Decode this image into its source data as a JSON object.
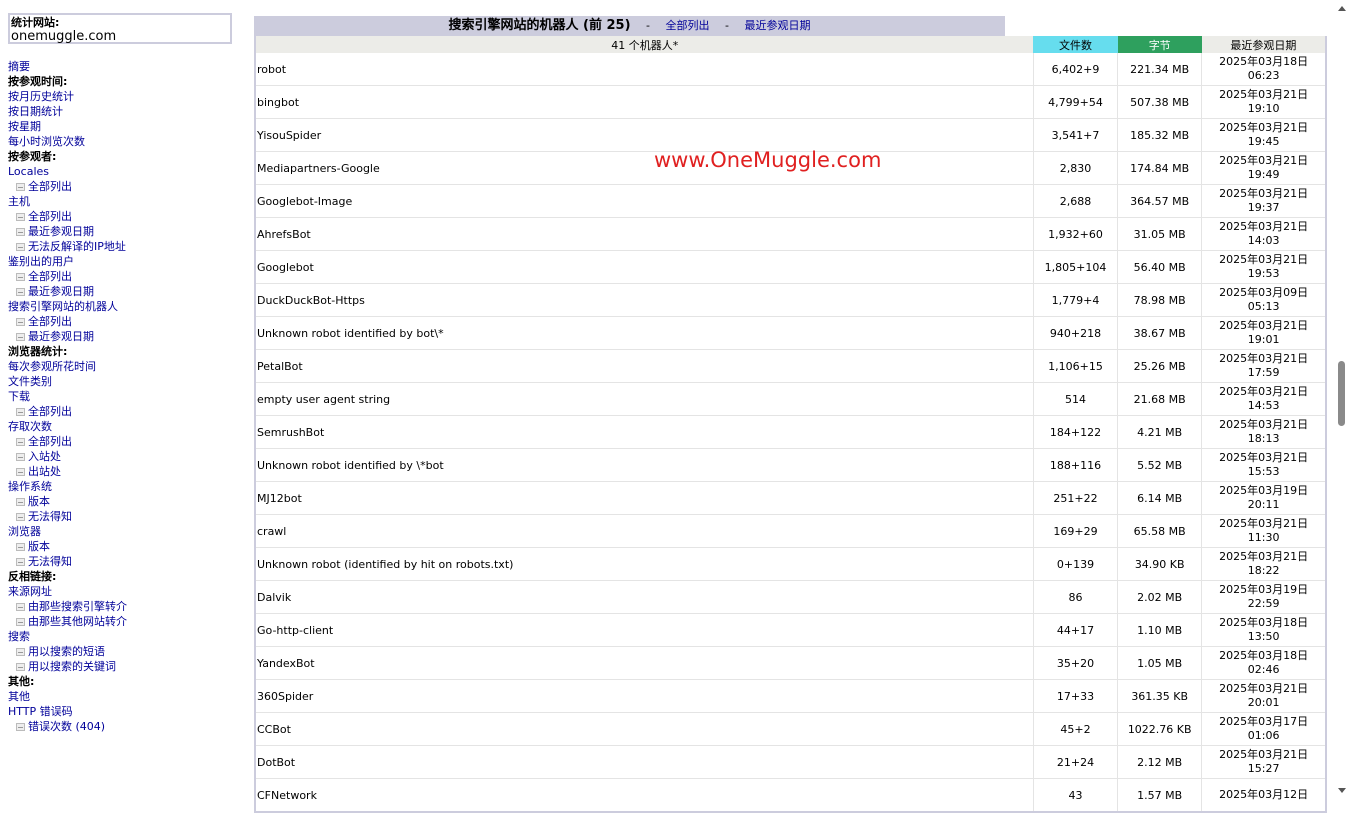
{
  "site": {
    "label": "统计网站:",
    "value": "onemuggle.com"
  },
  "menu": [
    {
      "text": "摘要",
      "type": "link"
    },
    {
      "text": "按参观时间:",
      "type": "header"
    },
    {
      "text": "按月历史统计",
      "type": "link"
    },
    {
      "text": "按日期统计",
      "type": "link"
    },
    {
      "text": "按星期",
      "type": "link"
    },
    {
      "text": "每小时浏览次数",
      "type": "link"
    },
    {
      "text": "按参观者:",
      "type": "header"
    },
    {
      "text": "Locales",
      "type": "link"
    },
    {
      "text": "全部列出",
      "type": "sub"
    },
    {
      "text": "主机",
      "type": "link"
    },
    {
      "text": "全部列出",
      "type": "sub"
    },
    {
      "text": "最近参观日期",
      "type": "sub"
    },
    {
      "text": "无法反解译的IP地址",
      "type": "sub"
    },
    {
      "text": "鉴别出的用户",
      "type": "link"
    },
    {
      "text": "全部列出",
      "type": "sub"
    },
    {
      "text": "最近参观日期",
      "type": "sub"
    },
    {
      "text": "搜索引擎网站的机器人",
      "type": "link"
    },
    {
      "text": "全部列出",
      "type": "sub"
    },
    {
      "text": "最近参观日期",
      "type": "sub"
    },
    {
      "text": "浏览器统计:",
      "type": "header"
    },
    {
      "text": "每次参观所花时间",
      "type": "link"
    },
    {
      "text": "文件类别",
      "type": "link"
    },
    {
      "text": "下载",
      "type": "link"
    },
    {
      "text": "全部列出",
      "type": "sub"
    },
    {
      "text": "存取次数",
      "type": "link"
    },
    {
      "text": "全部列出",
      "type": "sub"
    },
    {
      "text": "入站处",
      "type": "sub"
    },
    {
      "text": "出站处",
      "type": "sub"
    },
    {
      "text": "操作系统",
      "type": "link"
    },
    {
      "text": "版本",
      "type": "sub"
    },
    {
      "text": "无法得知",
      "type": "sub"
    },
    {
      "text": "浏览器",
      "type": "link"
    },
    {
      "text": "版本",
      "type": "sub"
    },
    {
      "text": "无法得知",
      "type": "sub"
    },
    {
      "text": "反相链接:",
      "type": "header"
    },
    {
      "text": "来源网址",
      "type": "link"
    },
    {
      "text": "由那些搜索引擎转介",
      "type": "sub"
    },
    {
      "text": "由那些其他网站转介",
      "type": "sub"
    },
    {
      "text": "搜索",
      "type": "link"
    },
    {
      "text": "用以搜索的短语",
      "type": "sub"
    },
    {
      "text": "用以搜索的关键词",
      "type": "sub"
    },
    {
      "text": "其他:",
      "type": "header"
    },
    {
      "text": "其他",
      "type": "link"
    },
    {
      "text": "HTTP 错误码",
      "type": "link"
    },
    {
      "text": "错误次数 (404)",
      "type": "sub"
    }
  ],
  "section": {
    "title": "搜索引擎网站的机器人 (前 25)",
    "separator": "-",
    "link_all": "全部列出",
    "link_last": "最近参观日期"
  },
  "table": {
    "count_label": "41 个机器人*",
    "col_hits": "文件数",
    "col_bytes": "字节",
    "col_last": "最近参观日期",
    "rows": [
      {
        "name": "robot",
        "hits": "6,402+9",
        "bytes": "221.34 MB",
        "date": "2025年03月18日",
        "time": "06:23"
      },
      {
        "name": "bingbot",
        "hits": "4,799+54",
        "bytes": "507.38 MB",
        "date": "2025年03月21日",
        "time": "19:10"
      },
      {
        "name": "YisouSpider",
        "hits": "3,541+7",
        "bytes": "185.32 MB",
        "date": "2025年03月21日",
        "time": "19:45"
      },
      {
        "name": "Mediapartners-Google",
        "hits": "2,830",
        "bytes": "174.84 MB",
        "date": "2025年03月21日",
        "time": "19:49"
      },
      {
        "name": "Googlebot-Image",
        "hits": "2,688",
        "bytes": "364.57 MB",
        "date": "2025年03月21日",
        "time": "19:37"
      },
      {
        "name": "AhrefsBot",
        "hits": "1,932+60",
        "bytes": "31.05 MB",
        "date": "2025年03月21日",
        "time": "14:03"
      },
      {
        "name": "Googlebot",
        "hits": "1,805+104",
        "bytes": "56.40 MB",
        "date": "2025年03月21日",
        "time": "19:53"
      },
      {
        "name": "DuckDuckBot-Https",
        "hits": "1,779+4",
        "bytes": "78.98 MB",
        "date": "2025年03月09日",
        "time": "05:13"
      },
      {
        "name": "Unknown robot identified by bot\\*",
        "hits": "940+218",
        "bytes": "38.67 MB",
        "date": "2025年03月21日",
        "time": "19:01"
      },
      {
        "name": "PetalBot",
        "hits": "1,106+15",
        "bytes": "25.26 MB",
        "date": "2025年03月21日",
        "time": "17:59"
      },
      {
        "name": "empty user agent string",
        "hits": "514",
        "bytes": "21.68 MB",
        "date": "2025年03月21日",
        "time": "14:53"
      },
      {
        "name": "SemrushBot",
        "hits": "184+122",
        "bytes": "4.21 MB",
        "date": "2025年03月21日",
        "time": "18:13"
      },
      {
        "name": "Unknown robot identified by \\*bot",
        "hits": "188+116",
        "bytes": "5.52 MB",
        "date": "2025年03月21日",
        "time": "15:53"
      },
      {
        "name": "MJ12bot",
        "hits": "251+22",
        "bytes": "6.14 MB",
        "date": "2025年03月19日",
        "time": "20:11"
      },
      {
        "name": "crawl",
        "hits": "169+29",
        "bytes": "65.58 MB",
        "date": "2025年03月21日",
        "time": "11:30"
      },
      {
        "name": "Unknown robot (identified by hit on robots.txt)",
        "hits": "0+139",
        "bytes": "34.90 KB",
        "date": "2025年03月21日",
        "time": "18:22"
      },
      {
        "name": "Dalvik",
        "hits": "86",
        "bytes": "2.02 MB",
        "date": "2025年03月19日",
        "time": "22:59"
      },
      {
        "name": "Go-http-client",
        "hits": "44+17",
        "bytes": "1.10 MB",
        "date": "2025年03月18日",
        "time": "13:50"
      },
      {
        "name": "YandexBot",
        "hits": "35+20",
        "bytes": "1.05 MB",
        "date": "2025年03月18日",
        "time": "02:46"
      },
      {
        "name": "360Spider",
        "hits": "17+33",
        "bytes": "361.35 KB",
        "date": "2025年03月21日",
        "time": "20:01"
      },
      {
        "name": "CCBot",
        "hits": "45+2",
        "bytes": "1022.76 KB",
        "date": "2025年03月17日",
        "time": "01:06"
      },
      {
        "name": "DotBot",
        "hits": "21+24",
        "bytes": "2.12 MB",
        "date": "2025年03月21日",
        "time": "15:27"
      },
      {
        "name": "CFNetwork",
        "hits": "43",
        "bytes": "1.57 MB",
        "date": "2025年03月12日",
        "time": ""
      }
    ]
  },
  "watermark": "www.OneMuggle.com",
  "colors": {
    "hits_header": "#66ddee",
    "bytes_header": "#2ea05e",
    "title_bg": "#ccccdd",
    "link": "#000099"
  }
}
